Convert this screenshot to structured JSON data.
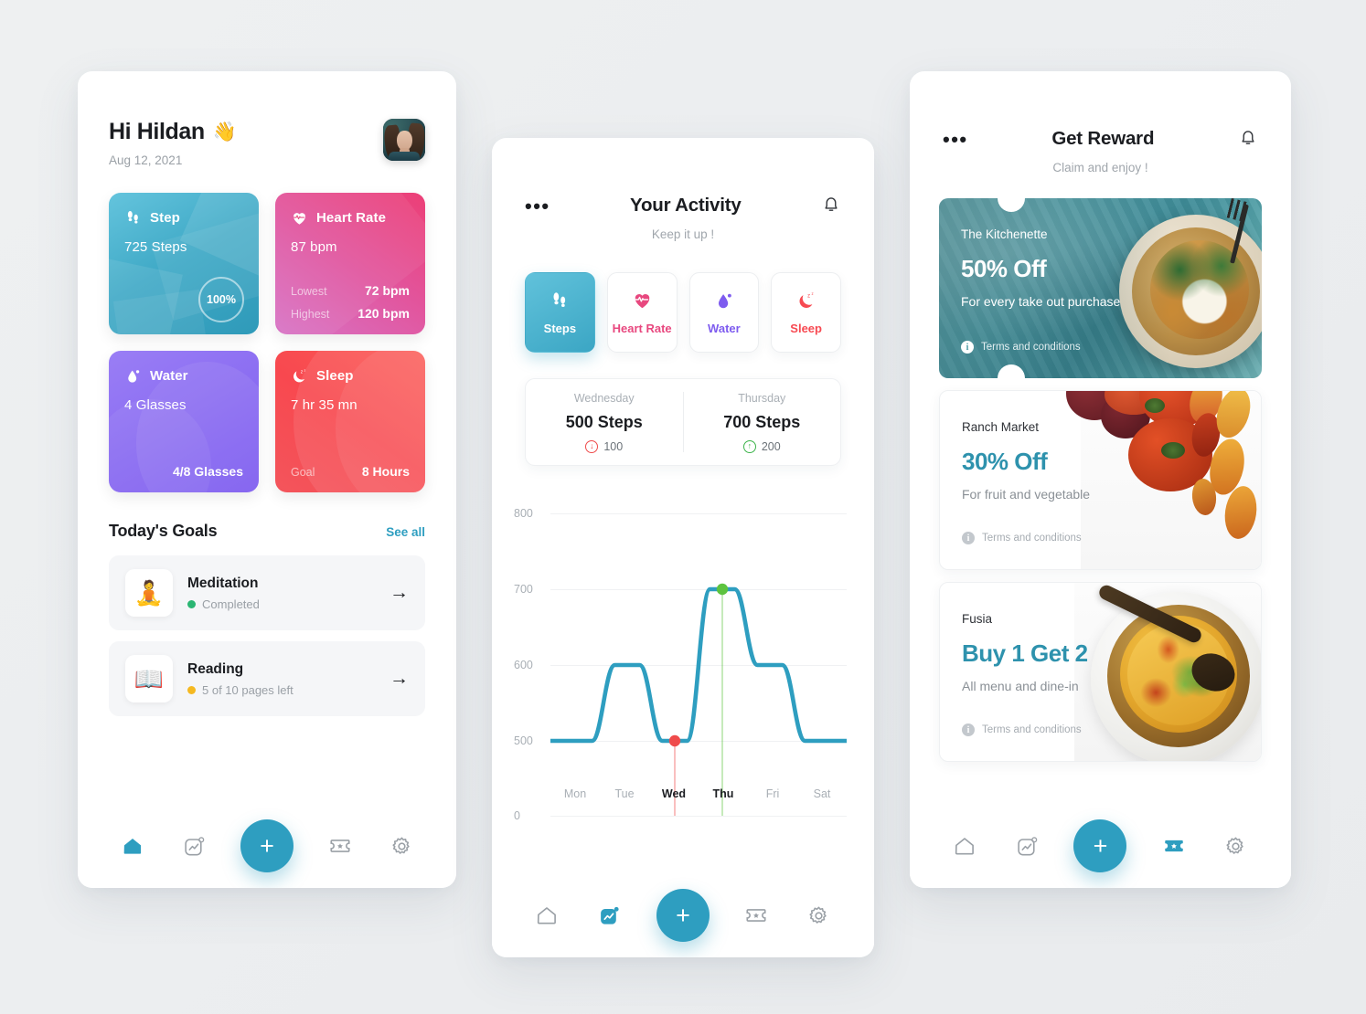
{
  "left": {
    "greeting": "Hi Hildan",
    "wave_emoji": "👋",
    "date": "Aug 12, 2021",
    "cards": [
      {
        "title": "Step",
        "icon": "footsteps-icon",
        "value": "725 Steps",
        "ring": "100%"
      },
      {
        "title": "Heart Rate",
        "icon": "heart-pulse-icon",
        "value": "87 bpm",
        "rows": [
          {
            "key": "Lowest",
            "val": "72 bpm"
          },
          {
            "key": "Highest",
            "val": "120 bpm"
          }
        ]
      },
      {
        "title": "Water",
        "icon": "water-drop-icon",
        "value": "4 Glasses",
        "footer": "4/8 Glasses"
      },
      {
        "title": "Sleep",
        "icon": "moon-zzz-icon",
        "value": "7 hr 35 mn",
        "rows": [
          {
            "key": "Goal",
            "val": "8 Hours"
          }
        ]
      }
    ],
    "goals_title": "Today's Goals",
    "see_all": "See all",
    "goals": [
      {
        "icon": "meditation-icon",
        "emoji": "🧘",
        "name": "Meditation",
        "status": "Completed",
        "status_color": "#2bb673"
      },
      {
        "icon": "book-icon",
        "emoji": "📖",
        "name": "Reading",
        "status": "5 of 10 pages left",
        "status_color": "#f5b921"
      }
    ],
    "nav": [
      {
        "name": "home",
        "label": "Home",
        "active": true
      },
      {
        "name": "activity",
        "label": "Activity",
        "active": false
      },
      {
        "name": "add",
        "label": "+",
        "active": false
      },
      {
        "name": "rewards",
        "label": "Rewards",
        "active": false
      },
      {
        "name": "settings",
        "label": "Settings",
        "active": false
      }
    ]
  },
  "center": {
    "menu": "•••",
    "title": "Your Activity",
    "subtitle": "Keep it up !",
    "bell": "bell-icon",
    "tabs": [
      {
        "label": "Steps",
        "icon": "footsteps-icon",
        "color": "#ffffff",
        "active": true
      },
      {
        "label": "Heart Rate",
        "icon": "heart-pulse-icon",
        "color": "#e8487f",
        "active": false
      },
      {
        "label": "Water",
        "icon": "water-drop-icon",
        "color": "#7e5cef",
        "active": false
      },
      {
        "label": "Sleep",
        "icon": "moon-zzz-icon",
        "color": "#f74a52",
        "active": false
      }
    ],
    "compare": [
      {
        "day": "Wednesday",
        "value": "500 Steps",
        "delta": "100",
        "dir": "down",
        "color": "#ef4b4b"
      },
      {
        "day": "Thursday",
        "value": "700 Steps",
        "delta": "200",
        "dir": "up",
        "color": "#3cb44a"
      }
    ],
    "nav": [
      {
        "name": "home",
        "label": "Home",
        "active": false
      },
      {
        "name": "activity",
        "label": "Activity",
        "active": true
      },
      {
        "name": "add",
        "label": "+",
        "active": false
      },
      {
        "name": "rewards",
        "label": "Rewards",
        "active": false
      },
      {
        "name": "settings",
        "label": "Settings",
        "active": false
      }
    ]
  },
  "chart_data": {
    "type": "line",
    "title": "Your Activity",
    "categories": [
      "Mon",
      "Tue",
      "Wed",
      "Thu",
      "Fri",
      "Sat"
    ],
    "values": [
      500,
      600,
      500,
      700,
      600,
      500
    ],
    "ylabel": "",
    "xlabel": "",
    "yticks": [
      0,
      500,
      600,
      700,
      800
    ],
    "ylim": [
      0,
      800
    ],
    "grid": true,
    "legend": "none",
    "line_color": "#2e9ec0",
    "markers": [
      {
        "x": "Wed",
        "y": 500,
        "color": "#ef4b4b",
        "label": "500 Steps"
      },
      {
        "x": "Thu",
        "y": 700,
        "color": "#5dc33f",
        "label": "700 Steps"
      }
    ],
    "highlighted_ticks": [
      "Wed",
      "Thu"
    ]
  },
  "right": {
    "menu": "•••",
    "title": "Get Reward",
    "subtitle": "Claim and enjoy !",
    "bell": "bell-icon",
    "terms": "Terms and conditions",
    "rewards": [
      {
        "brand": "The Kitchenette",
        "offer": "50% Off",
        "desc": "For every take out purchase",
        "style": "photo",
        "brand_color": "#ffffff",
        "offer_color": "#ffffff",
        "desc_color": "#ffffff",
        "tc_color": "#e2eef0"
      },
      {
        "brand": "Ranch Market",
        "offer": "30% Off",
        "desc": "For fruit and vegetable",
        "style": "light",
        "brand_color": "#2f3237",
        "offer_color": "#2e92ad",
        "desc_color": "#8a9096",
        "tc_color": "#a6acb2"
      },
      {
        "brand": "Fusia",
        "offer": "Buy 1 Get 2",
        "desc": "All menu and dine-in",
        "style": "light",
        "brand_color": "#2f3237",
        "offer_color": "#2e92ad",
        "desc_color": "#8a9096",
        "tc_color": "#a6acb2"
      }
    ],
    "nav": [
      {
        "name": "home",
        "label": "Home",
        "active": false
      },
      {
        "name": "activity",
        "label": "Activity",
        "active": false
      },
      {
        "name": "add",
        "label": "+",
        "active": false
      },
      {
        "name": "rewards",
        "label": "Rewards",
        "active": true
      },
      {
        "name": "settings",
        "label": "Settings",
        "active": false
      }
    ]
  },
  "theme": {
    "accent": "#2e9ec0",
    "step_color": "#3fa9c6",
    "heart_color": "#e8487f",
    "water_color": "#7e5cef",
    "sleep_color": "#f74a52",
    "bg": "#eef0f2"
  }
}
